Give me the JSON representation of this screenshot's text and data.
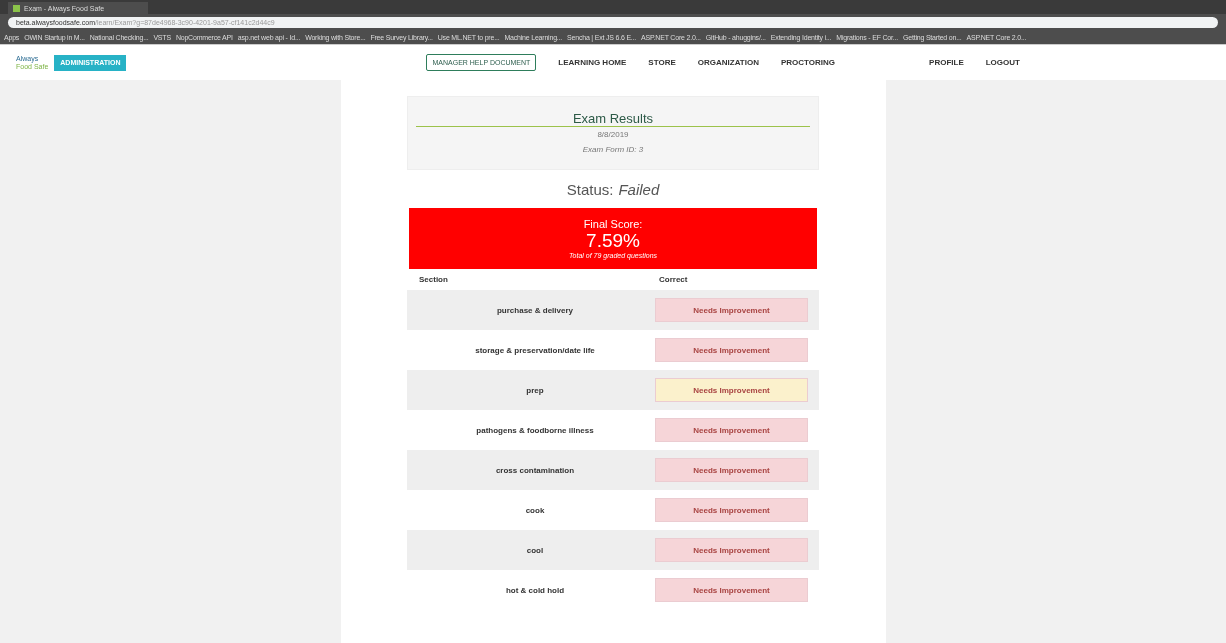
{
  "browser": {
    "tab_title": "Exam - Always Food Safe",
    "url_host": "beta.alwaysfoodsafe.com",
    "url_path": "/learn/Exam?g=87de4968-3c90-4201-9a57-cf141c2d44c9",
    "bookmarks": [
      "Apps",
      "OWIN Startup in M...",
      "National Checking...",
      "VSTS",
      "NopCommerce API",
      "asp.net web api - Id...",
      "Working with Store...",
      "Free Survey Library...",
      "Use ML.NET to pre...",
      "Machine Learning...",
      "Sencha | Ext JS 6.6 E...",
      "ASP.NET Core 2.0...",
      "GitHub - ahuggins/...",
      "Extending Identity i...",
      "Migrations - EF Cor...",
      "Getting Started on...",
      "ASP.NET Core 2.0..."
    ]
  },
  "nav": {
    "logo_top": "Always",
    "logo_bottom": "Food Safe",
    "admin_button": "ADMINISTRATION",
    "help_button": "MANAGER HELP DOCUMENT",
    "links": [
      "LEARNING HOME",
      "STORE",
      "ORGANIZATION",
      "PROCTORING"
    ],
    "right_links": [
      "PROFILE",
      "LOGOUT"
    ]
  },
  "exam": {
    "title": "Exam Results",
    "date": "8/8/2019",
    "form_id": "Exam Form ID: 3",
    "status_label": "Status:",
    "status": "Failed",
    "score_label": "Final Score:",
    "score": "7.59%",
    "score_note": "Total of 79 graded questions"
  },
  "table": {
    "columns": [
      "Section",
      "Correct"
    ],
    "rows": [
      {
        "section": "purchase & delivery",
        "result": "Needs Improvement",
        "color": "#f6d5d8"
      },
      {
        "section": "storage & preservation/date life",
        "result": "Needs Improvement",
        "color": "#f6d5d8"
      },
      {
        "section": "prep",
        "result": "Needs Improvement",
        "color": "#fbf1cc"
      },
      {
        "section": "pathogens & foodborne illness",
        "result": "Needs Improvement",
        "color": "#f6d5d8"
      },
      {
        "section": "cross contamination",
        "result": "Needs Improvement",
        "color": "#f6d5d8"
      },
      {
        "section": "cook",
        "result": "Needs Improvement",
        "color": "#f6d5d8"
      },
      {
        "section": "cool",
        "result": "Needs Improvement",
        "color": "#f6d5d8"
      },
      {
        "section": "hot & cold hold",
        "result": "Needs Improvement",
        "color": "#f6d5d8"
      }
    ]
  }
}
